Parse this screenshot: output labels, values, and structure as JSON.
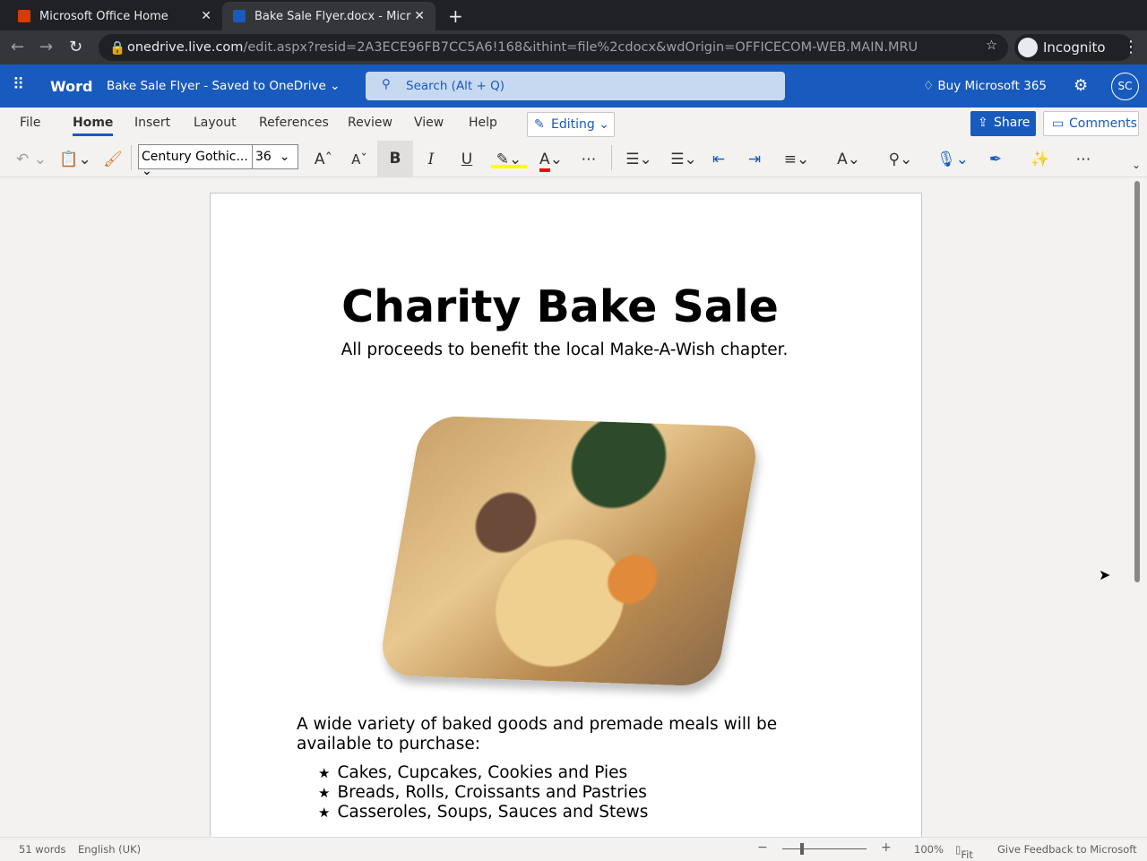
{
  "browser": {
    "tabs": [
      {
        "title": "Microsoft Office Home"
      },
      {
        "title": "Bake Sale Flyer.docx - Micr"
      }
    ],
    "url_domain": "onedrive.live.com",
    "url_path": "/edit.aspx?resid=2A3ECE96FB7CC5A6!168&ithint=file%2cdocx&wdOrigin=OFFICECOM-WEB.MAIN.MRU",
    "profile": "Incognito"
  },
  "app": {
    "name": "Word",
    "doc_status": "Bake Sale Flyer  -  Saved to OneDrive ⌄",
    "search_placeholder": "Search (Alt + Q)",
    "buy": "Buy Microsoft 365",
    "avatar": "SC"
  },
  "ribbon": {
    "tabs": [
      "File",
      "Home",
      "Insert",
      "Layout",
      "References",
      "Review",
      "View",
      "Help"
    ],
    "editing": "Editing ⌄",
    "share": "Share",
    "comments": "Comments",
    "font": "Century Gothic...",
    "size": "36"
  },
  "doc": {
    "title": "Charity Bake Sale",
    "subtitle": "All proceeds to benefit the local Make-A-Wish chapter.",
    "para": "A wide variety of baked goods and premade meals will be available to purchase:",
    "items": [
      "Cakes, Cupcakes, Cookies and Pies",
      "Breads, Rolls, Croissants and Pastries",
      "Casseroles, Soups, Sauces and Stews"
    ]
  },
  "status": {
    "words": "51 words",
    "lang": "English (UK)",
    "zoom": "100%",
    "fit": "Fit",
    "feedback": "Give Feedback to Microsoft"
  },
  "colors": {
    "brand": "#185abd",
    "highlight": "#ffff00",
    "font_color": "#ff0000"
  }
}
